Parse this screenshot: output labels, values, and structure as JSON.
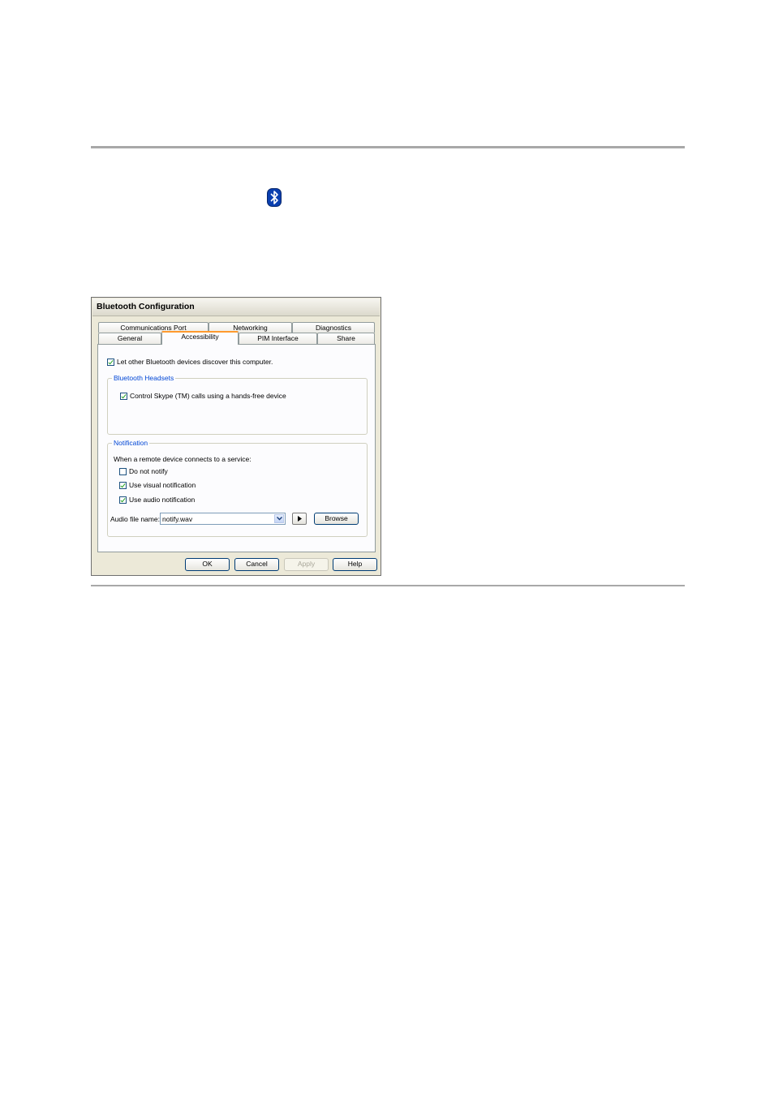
{
  "dialog": {
    "title": "Bluetooth Configuration",
    "tabs_row_back": [
      "Communications Port",
      "Networking",
      "Diagnostics"
    ],
    "tabs_row_front": [
      "General",
      "Accessibility",
      "PIM Interface",
      "Share"
    ],
    "active_tab": "Accessibility",
    "discover_checkbox": {
      "label": "Let other Bluetooth devices discover this computer.",
      "checked": true
    },
    "headsets": {
      "group_label": "Bluetooth Headsets",
      "skype_checkbox": {
        "label": "Control Skype (TM) calls using a hands-free device",
        "checked": true
      }
    },
    "notification": {
      "group_label": "Notification",
      "prompt": "When a remote device connects to a service:",
      "do_not_notify": {
        "label": "Do not notify",
        "checked": false
      },
      "visual": {
        "label": "Use visual notification",
        "checked": true
      },
      "audio": {
        "label": "Use audio notification",
        "checked": true
      },
      "audio_file_label": "Audio file name:",
      "audio_file_value": "notify.wav",
      "browse_label": "Browse"
    },
    "buttons": {
      "ok": "OK",
      "cancel": "Cancel",
      "apply": "Apply",
      "help": "Help"
    }
  },
  "icons": {
    "bluetooth": "bluetooth-icon",
    "dropdown": "chevron-down-icon",
    "play": "play-icon"
  },
  "colors": {
    "group_label": "#0046d5",
    "active_tab_accent": "#ff9a2e",
    "bluetooth_blue": "#0a3fb0",
    "check": "#21a121"
  }
}
